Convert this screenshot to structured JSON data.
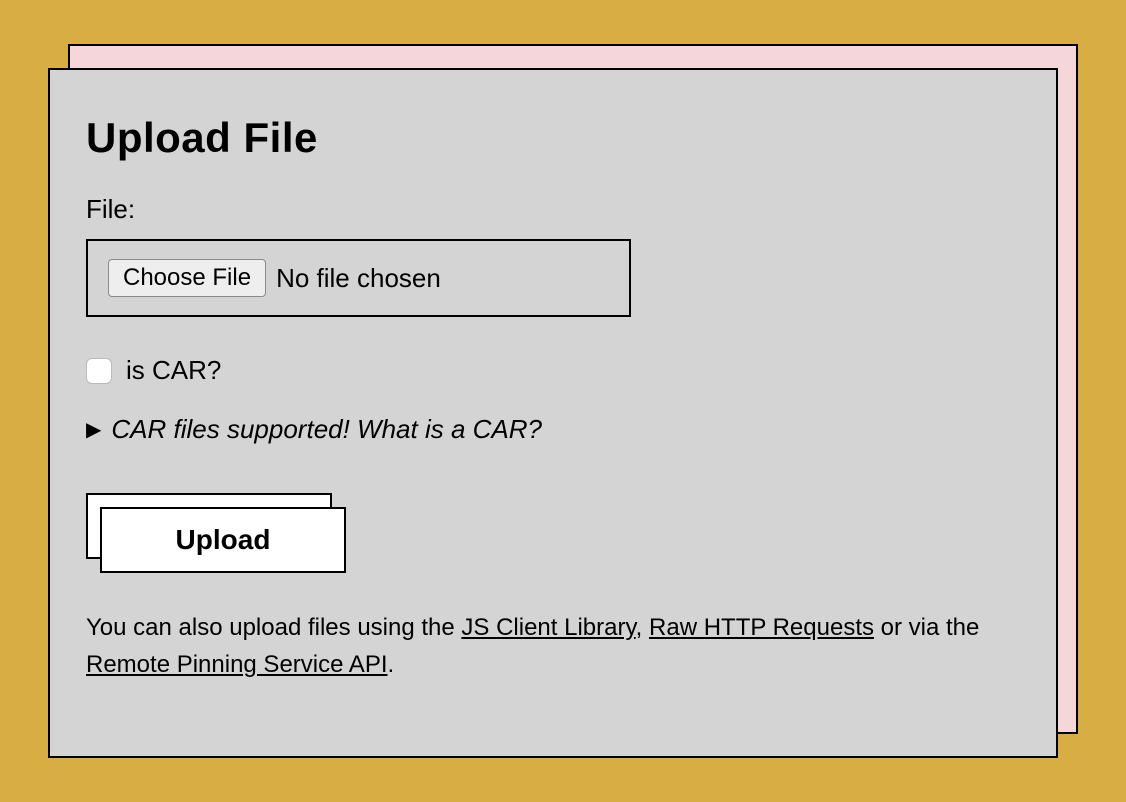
{
  "title": "Upload File",
  "file": {
    "label": "File:",
    "choose_button": "Choose File",
    "status": "No file chosen"
  },
  "is_car": {
    "label": "is CAR?",
    "checked": false
  },
  "details": {
    "summary": "CAR files supported! What is a CAR?"
  },
  "upload_button": "Upload",
  "footer": {
    "prefix": "You can also upload files using the ",
    "link1": "JS Client Library",
    "sep1": ", ",
    "link2": "Raw HTTP Requests",
    "sep2": " or via the ",
    "link3": "Remote Pinning Service API",
    "suffix": "."
  }
}
